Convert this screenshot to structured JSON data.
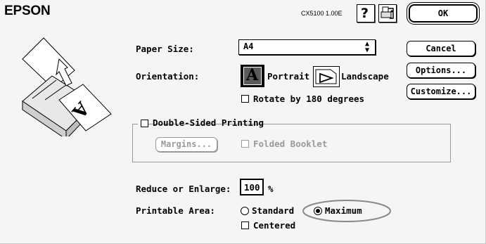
{
  "header": {
    "brand": "EPSON",
    "version": "CX5100 1.00E",
    "help_icon": "question-mark-help-icon",
    "utility_icon": "printer-utility-icon"
  },
  "buttons": {
    "ok": "OK",
    "cancel": "Cancel",
    "options": "Options...",
    "customize": "Customize..."
  },
  "paper_size": {
    "label": "Paper Size:",
    "value": "A4"
  },
  "orientation": {
    "label": "Orientation:",
    "portrait": "Portrait",
    "landscape": "Landscape",
    "selected": "portrait",
    "rotate_label": "Rotate by 180 degrees",
    "rotate_checked": false
  },
  "double_sided": {
    "label": "Double-Sided Printing",
    "checked": false,
    "margins_button": "Margins...",
    "folded_booklet": "Folded Booklet"
  },
  "reduce": {
    "label": "Reduce or Enlarge:",
    "value": "100",
    "unit": "%"
  },
  "printable_area": {
    "label": "Printable Area:",
    "standard": "Standard",
    "maximum": "Maximum",
    "selected": "maximum",
    "centered_label": "Centered",
    "centered_checked": false
  },
  "colors": {
    "highlight_ellipse": "#8a8a8a",
    "disabled": "#9a9a9a"
  }
}
